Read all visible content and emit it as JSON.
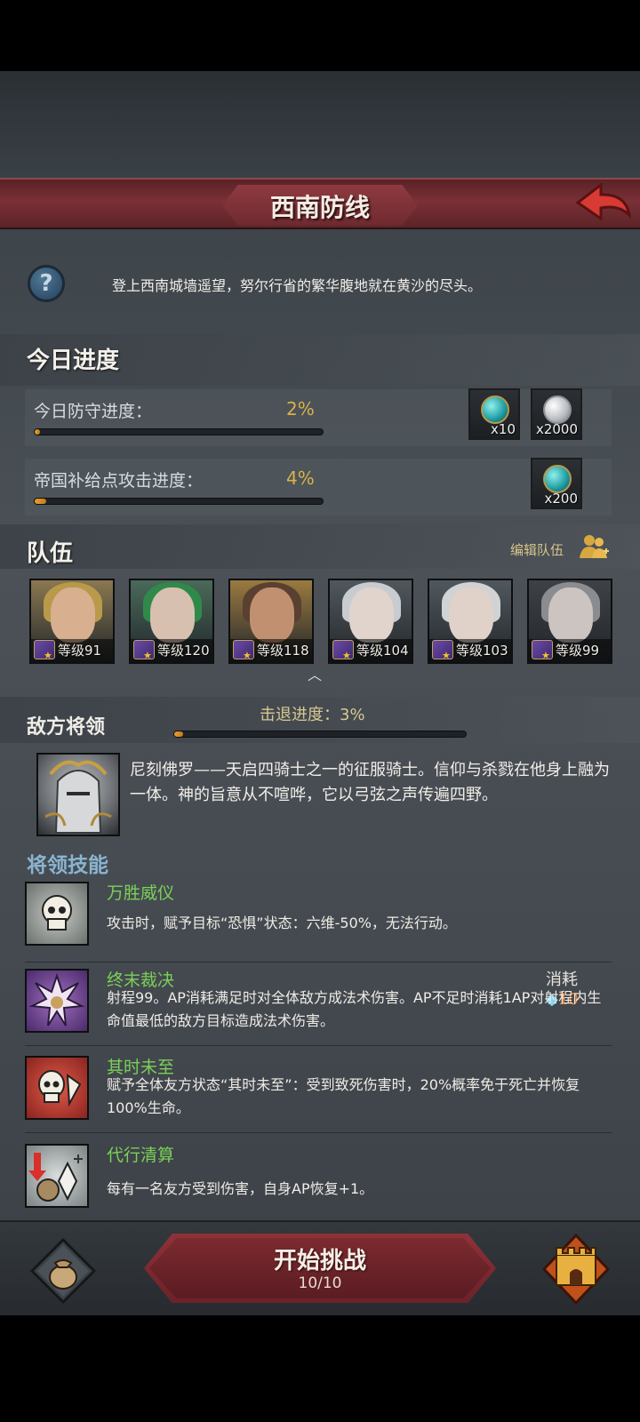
{
  "header": {
    "title": "西南防线"
  },
  "intro": {
    "text": "登上西南城墙遥望，努尔行省的繁华腹地就在黄沙的尽头。"
  },
  "today": {
    "title": "今日进度",
    "rows": [
      {
        "label": "今日防守进度：",
        "percent": "2%",
        "progress": 0.02,
        "rewards": [
          {
            "type": "gem-icon",
            "qty": "x10"
          },
          {
            "type": "silver-coin-icon",
            "qty": "x2000"
          }
        ]
      },
      {
        "label": "帝国补给点攻击进度：",
        "percent": "4%",
        "progress": 0.04,
        "rewards": [
          {
            "type": "gem-icon",
            "qty": "x200"
          }
        ]
      }
    ]
  },
  "team": {
    "title": "队伍",
    "edit_label": "编辑队伍",
    "heroes": [
      {
        "level": "等级91",
        "skin": "#d8b090",
        "hair": "#b89a4a",
        "bg": "#8a7850"
      },
      {
        "level": "等级120",
        "skin": "#d8c0b0",
        "hair": "#2f8a4a",
        "bg": "#4a6a5a"
      },
      {
        "level": "等级118",
        "skin": "#c09070",
        "hair": "#5a4030",
        "bg": "#9a7a40"
      },
      {
        "level": "等级104",
        "skin": "#e0d4cc",
        "hair": "#c8ccd0",
        "bg": "#50585e"
      },
      {
        "level": "等级103",
        "skin": "#e0d2c8",
        "hair": "#d0d2d4",
        "bg": "#50585e"
      },
      {
        "level": "等级99",
        "skin": "#ccc4c0",
        "hair": "#8a8c90",
        "bg": "#3e4246"
      }
    ]
  },
  "enemy": {
    "title": "敌方将领",
    "repel_label": "击退进度：3%",
    "repel_progress": 0.03,
    "description": "尼刻佛罗——天启四骑士之一的征服骑士。信仰与杀戮在他身上融为一体。神的旨意从不喧哗，它以弓弦之声传遍四野。"
  },
  "skills": {
    "title": "将领技能",
    "items": [
      {
        "name": "万胜威仪",
        "text": "攻击时，赋予目标“恐惧”状态：六维-50%，无法行动。",
        "icon": "skull-icon",
        "color": "#9aa0a0"
      },
      {
        "name": "终末裁决",
        "text": "射程99。AP消耗满足时对全体敌方成法术伤害。AP不足时消耗1AP对射程内生命值最低的敌方目标造成法术伤害。",
        "icon": "burst-icon",
        "color": "#6a3a8a",
        "cost_label": "消耗",
        "cost_value": "10"
      },
      {
        "name": "其时未至",
        "text": "赋予全体友方状态“其时未至”：受到致死伤害时，20%概率免于死亡并恢复100%生命。",
        "icon": "skull-icon",
        "color": "#b83a30"
      },
      {
        "name": "代行清算",
        "text": "每有一名友方受到伤害，自身AP恢复+1。",
        "icon": "bag-arrow-icon",
        "color": "#a0a8a8"
      }
    ]
  },
  "footer": {
    "start_label": "开始挑战",
    "start_count": "10/10"
  }
}
